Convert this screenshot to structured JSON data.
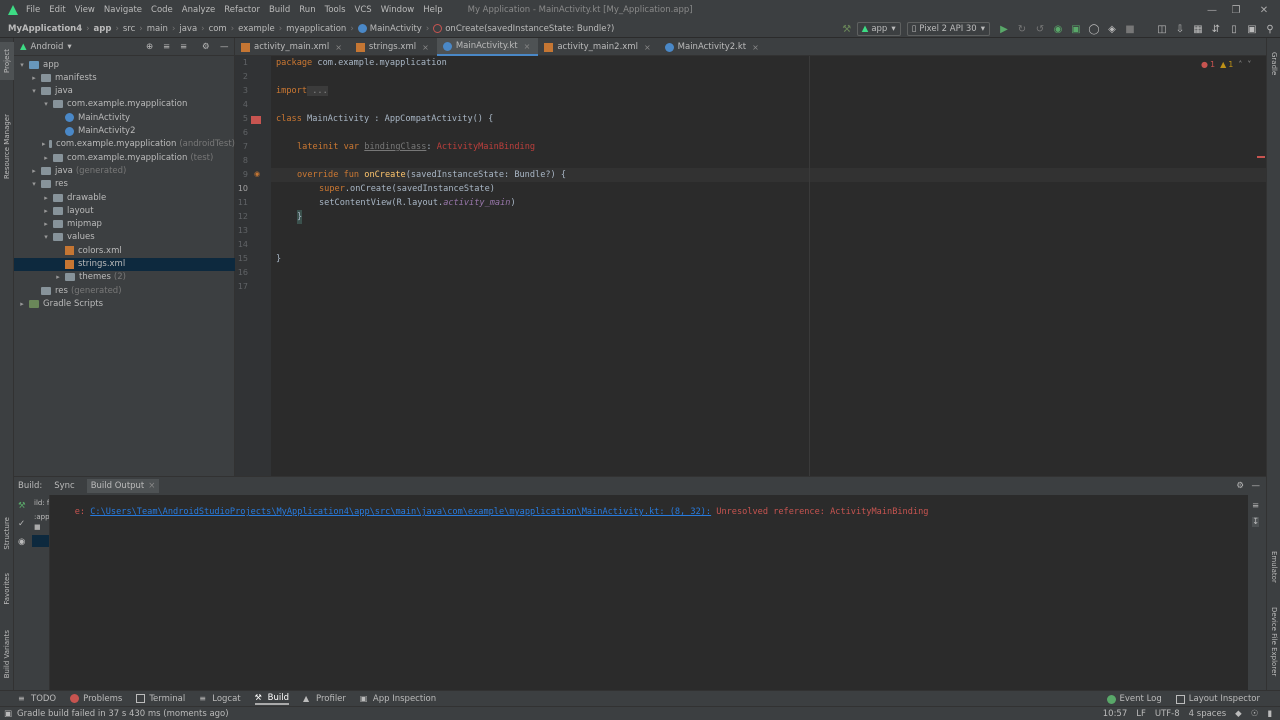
{
  "menu": {
    "items": [
      "File",
      "Edit",
      "View",
      "Navigate",
      "Code",
      "Analyze",
      "Refactor",
      "Build",
      "Run",
      "Tools",
      "VCS",
      "Window",
      "Help"
    ],
    "window_title": "My Application - MainActivity.kt [My_Application.app]"
  },
  "breadcrumb": {
    "items": [
      "MyApplication4",
      "app",
      "src",
      "main",
      "java",
      "com",
      "example",
      "myapplication",
      "MainActivity",
      "onCreate(savedInstanceState: Bundle?)"
    ]
  },
  "run_toolbar": {
    "config": "app",
    "device": "Pixel 2 API 30"
  },
  "project": {
    "view_mode": "Android",
    "tree": [
      {
        "label": "app",
        "depth": 0,
        "type": "folder-blue",
        "expanded": true
      },
      {
        "label": "manifests",
        "depth": 1,
        "type": "folder",
        "expanded": false
      },
      {
        "label": "java",
        "depth": 1,
        "type": "folder",
        "expanded": true
      },
      {
        "label": "com.example.myapplication",
        "depth": 2,
        "type": "folder",
        "expanded": true
      },
      {
        "label": "MainActivity",
        "depth": 3,
        "type": "kt"
      },
      {
        "label": "MainActivity2",
        "depth": 3,
        "type": "kt"
      },
      {
        "label": "com.example.myapplication",
        "depth": 2,
        "type": "folder",
        "expanded": false,
        "note": "(androidTest)"
      },
      {
        "label": "com.example.myapplication",
        "depth": 2,
        "type": "folder",
        "expanded": false,
        "note": "(test)"
      },
      {
        "label": "java",
        "depth": 1,
        "type": "folder",
        "expanded": false,
        "note": "(generated)"
      },
      {
        "label": "res",
        "depth": 1,
        "type": "folder",
        "expanded": true
      },
      {
        "label": "drawable",
        "depth": 2,
        "type": "folder",
        "expanded": false
      },
      {
        "label": "layout",
        "depth": 2,
        "type": "folder",
        "expanded": false
      },
      {
        "label": "mipmap",
        "depth": 2,
        "type": "folder",
        "expanded": false
      },
      {
        "label": "values",
        "depth": 2,
        "type": "folder",
        "expanded": true
      },
      {
        "label": "colors.xml",
        "depth": 3,
        "type": "xml"
      },
      {
        "label": "strings.xml",
        "depth": 3,
        "type": "xml",
        "selected": true
      },
      {
        "label": "themes",
        "depth": 3,
        "type": "folder",
        "expanded": false,
        "note": "(2)"
      },
      {
        "label": "res",
        "depth": 1,
        "type": "folder",
        "note": "(generated)"
      },
      {
        "label": "Gradle Scripts",
        "depth": 0,
        "type": "gradle",
        "expanded": false
      }
    ]
  },
  "editor_tabs": [
    {
      "label": "activity_main.xml",
      "type": "xml"
    },
    {
      "label": "strings.xml",
      "type": "xml"
    },
    {
      "label": "MainActivity.kt",
      "type": "kt",
      "active": true
    },
    {
      "label": "activity_main2.xml",
      "type": "xml"
    },
    {
      "label": "MainActivity2.kt",
      "type": "kt"
    }
  ],
  "editor": {
    "line_numbers": [
      "1",
      "2",
      "3",
      "4",
      "5",
      "6",
      "7",
      "8",
      "9",
      "10",
      "11",
      "12",
      "13",
      "14",
      "15",
      "16",
      "17"
    ],
    "current_line": "10",
    "code": {
      "l1_kw": "package",
      "l1_rest": " com.example.myapplication",
      "l3_kw": "import",
      "l3_rest": " ...",
      "l6_kw": "class",
      "l6_rest": " MainActivity : AppCompatActivity() {",
      "l8_kw": "lateinit var",
      "l8_name": "bindingClass",
      "l8_colon": ": ",
      "l8_type": "ActivityMainBinding",
      "l10_kw": "override fun",
      "l10_fn": "onCreate",
      "l10_rest": "(savedInstanceState: Bundle?) {",
      "l11_kw": "super",
      "l11_rest": ".onCreate(savedInstanceState)",
      "l12_a": "setContentView(R.layout.",
      "l12_b": "activity_main",
      "l12_c": ")",
      "l13": "}",
      "l16": "}"
    },
    "inspection": {
      "errors": "1",
      "warnings": "1"
    }
  },
  "build": {
    "header_label": "Build:",
    "tabs": [
      "Sync",
      "Build Output"
    ],
    "tree_fragments": [
      "ild: f",
      ":app"
    ],
    "output_prefix": "e: ",
    "output_path": "C:\\Users\\Team\\AndroidStudioProjects\\MyApplication4\\app\\src\\main\\java\\com\\example\\myapplication\\MainActivity.kt: (8, 32):",
    "output_message": " Unresolved reference: ActivityMainBinding"
  },
  "side_tabs": {
    "left_top": [
      "Project",
      "Resource Manager"
    ],
    "left_bottom": [
      "Structure",
      "Favorites",
      "Build Variants"
    ],
    "right_top": [
      "Gradle"
    ],
    "right_bottom": [
      "Emulator",
      "Device File Explorer"
    ]
  },
  "tool_windows": [
    "TODO",
    "Problems",
    "Terminal",
    "Logcat",
    "Build",
    "Profiler",
    "App Inspection"
  ],
  "tool_windows_right": [
    "Event Log",
    "Layout Inspector"
  ],
  "status": {
    "message": "Gradle build failed in 37 s 430 ms (moments ago)",
    "position": "10:57",
    "line_sep": "LF",
    "encoding": "UTF-8",
    "indent": "4 spaces"
  },
  "colors": {
    "accent": "#4a88c7",
    "error": "#c75450",
    "keyword": "#cc7832",
    "function": "#ffc66d"
  }
}
